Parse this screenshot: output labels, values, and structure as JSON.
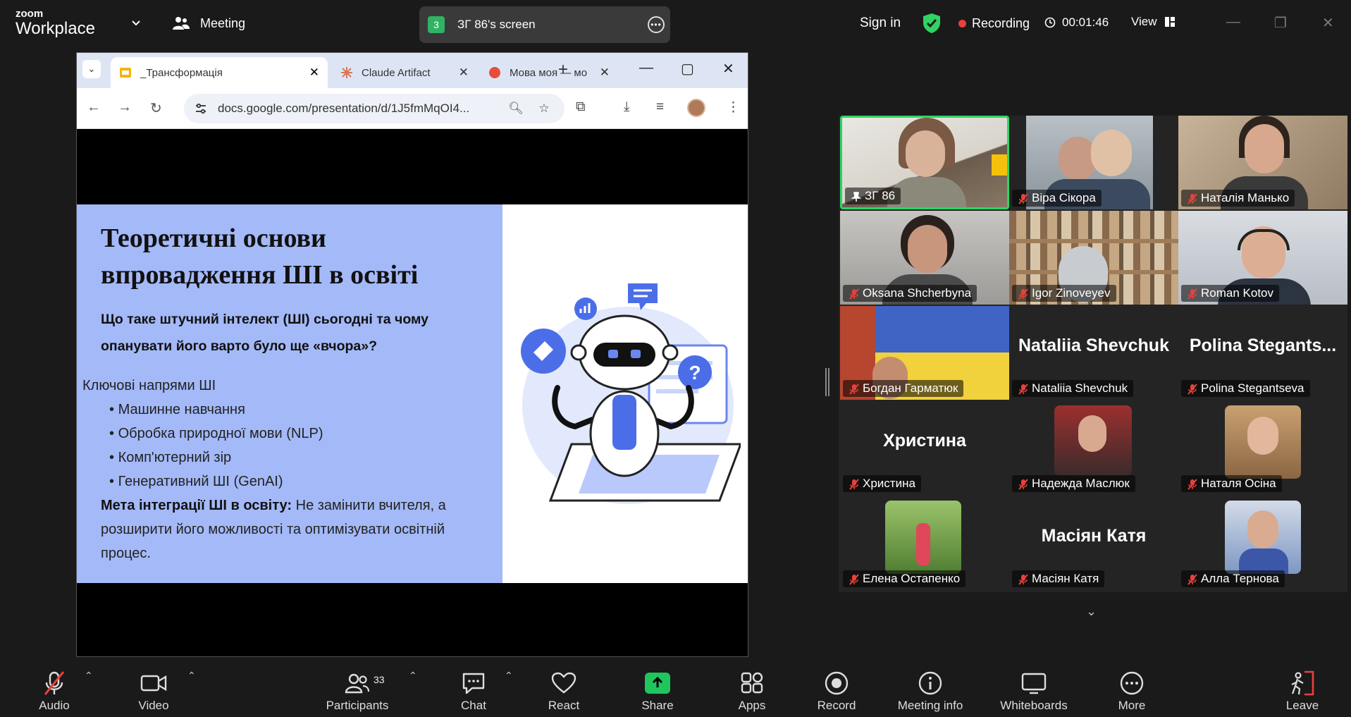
{
  "topbar": {
    "logo_line1": "zoom",
    "logo_line2": "Workplace",
    "meeting_label": "Meeting",
    "share_number": "3",
    "share_label": "ЗГ 86's screen",
    "signin": "Sign in",
    "recording": "Recording",
    "timer": "00:01:46",
    "view": "View"
  },
  "browser": {
    "tabs": [
      {
        "title": "_Трансформація",
        "active": true
      },
      {
        "title": "Claude Artifact",
        "active": false
      },
      {
        "title": "Мова моя — мо",
        "active": false
      }
    ],
    "url": "docs.google.com/presentation/d/1J5fmMqOI4..."
  },
  "slide": {
    "title": "Теоретичні основи впровадження ШІ в освіті",
    "subtitle": "Що таке штучний інтелект (ШІ) сьогодні та чому опанувати його варто було ще «вчора»?",
    "directions_label": "Ключові напрями ШІ",
    "directions": [
      "Машинне навчання",
      "Обробка природної мови (NLP)",
      "Комп'ютерний зір",
      "Генеративний ШІ (GenAI)"
    ],
    "goal_label": "Мета інтеграції ШІ в освіту:",
    "goal_text": " Не замінити вчителя, а розширити його можливості та оптимізувати освітній процес."
  },
  "participants": [
    {
      "name": "ЗГ 86",
      "video": true,
      "muted": false,
      "pinned": true,
      "selected": true
    },
    {
      "name": "Віра Сікора",
      "video": true,
      "muted": true
    },
    {
      "name": "Наталія Манько",
      "video": true,
      "muted": true
    },
    {
      "name": "Oksana Shcherbyna",
      "video": true,
      "muted": true
    },
    {
      "name": "Igor Zinoveyev",
      "video": true,
      "muted": true
    },
    {
      "name": "Roman Kotov",
      "video": true,
      "muted": true
    },
    {
      "name": "Богдан Гарматюк",
      "video": true,
      "muted": true
    },
    {
      "name": "Nataliia Shevchuk",
      "display": "Nataliia Shevchuk",
      "video": false,
      "muted": true
    },
    {
      "name": "Polina Stegantseva",
      "display": "Polina  Stegants...",
      "video": false,
      "muted": true
    },
    {
      "name": "Христина",
      "display": "Христина",
      "video": false,
      "muted": true
    },
    {
      "name": "Надежда Маслюк",
      "video": true,
      "muted": true
    },
    {
      "name": "Наталя Осіна",
      "video": true,
      "muted": true
    },
    {
      "name": "Елена Остапенко",
      "video": true,
      "muted": true
    },
    {
      "name": "Масіян Катя",
      "display": "Масіян Катя",
      "video": false,
      "muted": true
    },
    {
      "name": "Алла Тернова",
      "video": true,
      "muted": true
    }
  ],
  "toolbar": {
    "audio": "Audio",
    "video": "Video",
    "participants": "Participants",
    "participants_count": "33",
    "chat": "Chat",
    "react": "React",
    "share": "Share",
    "apps": "Apps",
    "record": "Record",
    "meeting_info": "Meeting info",
    "whiteboards": "Whiteboards",
    "more": "More",
    "leave": "Leave"
  },
  "colors": {
    "accent_green": "#2fd464",
    "share_green": "#1fc65e",
    "record_red": "#e8413b",
    "slide_blue": "#a4b9f7"
  }
}
